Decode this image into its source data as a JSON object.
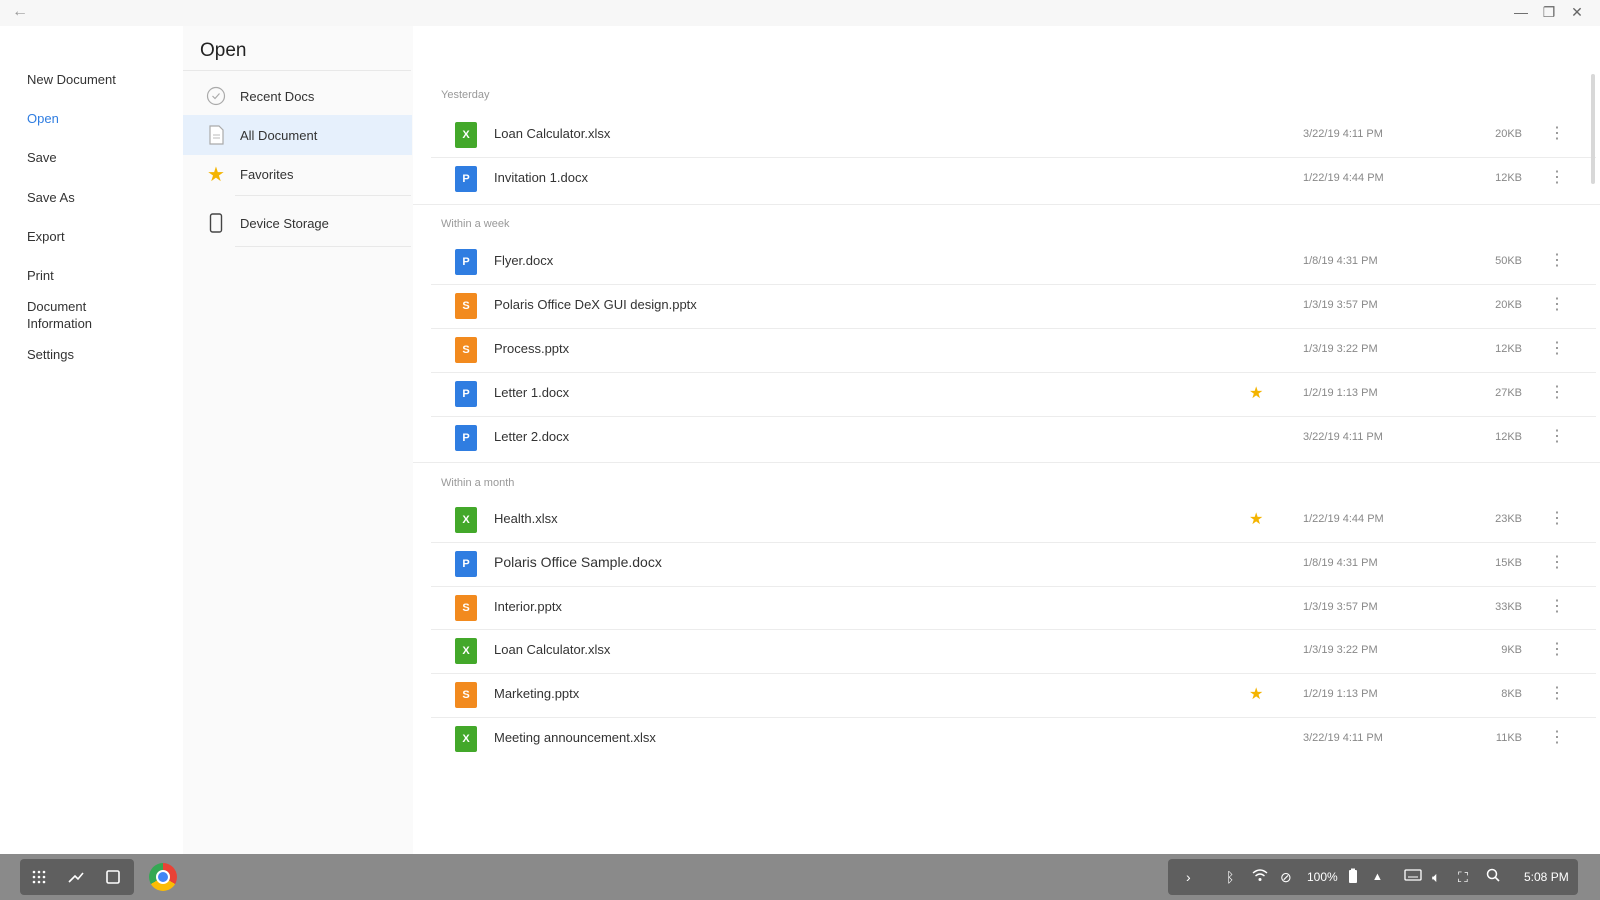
{
  "window": {
    "back_icon": "back-arrow-icon",
    "minimize": "—",
    "maximize": "❐",
    "close": "✕"
  },
  "left_menu": [
    {
      "label": "New Document"
    },
    {
      "label": "Open"
    },
    {
      "label": "Save"
    },
    {
      "label": "Save As"
    },
    {
      "label": "Export"
    },
    {
      "label": "Print"
    },
    {
      "label": "Document Information"
    },
    {
      "label": "Settings"
    }
  ],
  "open_panel": {
    "title": "Open",
    "nav": [
      {
        "label": "Recent Docs",
        "icon": "clock-icon"
      },
      {
        "label": "All Document",
        "icon": "document-icon"
      },
      {
        "label": "Favorites",
        "icon": "star-icon"
      },
      {
        "label": "Device Storage",
        "icon": "phone-icon"
      }
    ]
  },
  "sections": [
    {
      "title": "Yesterday",
      "files": [
        {
          "name": "Loan Calculator.xlsx",
          "type": "xlsx",
          "favorite": false,
          "date": "3/22/19 4:11 PM",
          "size": "20KB"
        },
        {
          "name": "Invitation 1.docx",
          "type": "docx",
          "favorite": false,
          "date": "1/22/19 4:44 PM",
          "size": "12KB"
        }
      ]
    },
    {
      "title": "Within a week",
      "files": [
        {
          "name": "Flyer.docx",
          "type": "docx",
          "favorite": false,
          "date": "1/8/19 4:31 PM",
          "size": "50KB"
        },
        {
          "name": "Polaris Office DeX GUI design.pptx",
          "type": "pptx",
          "favorite": false,
          "date": "1/3/19 3:57 PM",
          "size": "20KB"
        },
        {
          "name": "Process.pptx",
          "type": "pptx",
          "favorite": false,
          "date": "1/3/19 3:22 PM",
          "size": "12KB"
        },
        {
          "name": "Letter 1.docx",
          "type": "docx",
          "favorite": true,
          "date": "1/2/19 1:13 PM",
          "size": "27KB"
        },
        {
          "name": "Letter 2.docx",
          "type": "docx",
          "favorite": false,
          "date": "3/22/19 4:11 PM",
          "size": "12KB"
        }
      ]
    },
    {
      "title": "Within a month",
      "files": [
        {
          "name": "Health.xlsx",
          "type": "xlsx",
          "favorite": true,
          "date": "1/22/19 4:44 PM",
          "size": "23KB"
        },
        {
          "name": "Polaris Office Sample.docx",
          "type": "docx",
          "favorite": false,
          "date": "1/8/19 4:31 PM",
          "size": "15KB"
        },
        {
          "name": "Interior.pptx",
          "type": "pptx",
          "favorite": false,
          "date": "1/3/19 3:57 PM",
          "size": "33KB"
        },
        {
          "name": "Loan Calculator.xlsx",
          "type": "xlsx",
          "favorite": false,
          "date": "1/3/19 3:22 PM",
          "size": "9KB"
        },
        {
          "name": "Marketing.pptx",
          "type": "pptx",
          "favorite": true,
          "date": "1/2/19 1:13 PM",
          "size": "8KB"
        },
        {
          "name": "Meeting announcement.xlsx",
          "type": "xlsx",
          "favorite": false,
          "date": "3/22/19 4:11 PM",
          "size": "11KB"
        }
      ]
    }
  ],
  "file_type_letters": {
    "xlsx": "X",
    "docx": "P",
    "pptx": "S"
  },
  "colors": {
    "accent": "#2f7de1",
    "xlsx": "#43a82a",
    "docx": "#2f7de1",
    "pptx": "#f28a1e",
    "favorite": "#f4b400",
    "selected_bg": "#e6f0fc"
  },
  "taskbar": {
    "left_icons": [
      "apps-icon",
      "recent-apps-icon",
      "window-icon"
    ],
    "tray": {
      "battery": "100%",
      "time": "5:08 PM"
    }
  }
}
